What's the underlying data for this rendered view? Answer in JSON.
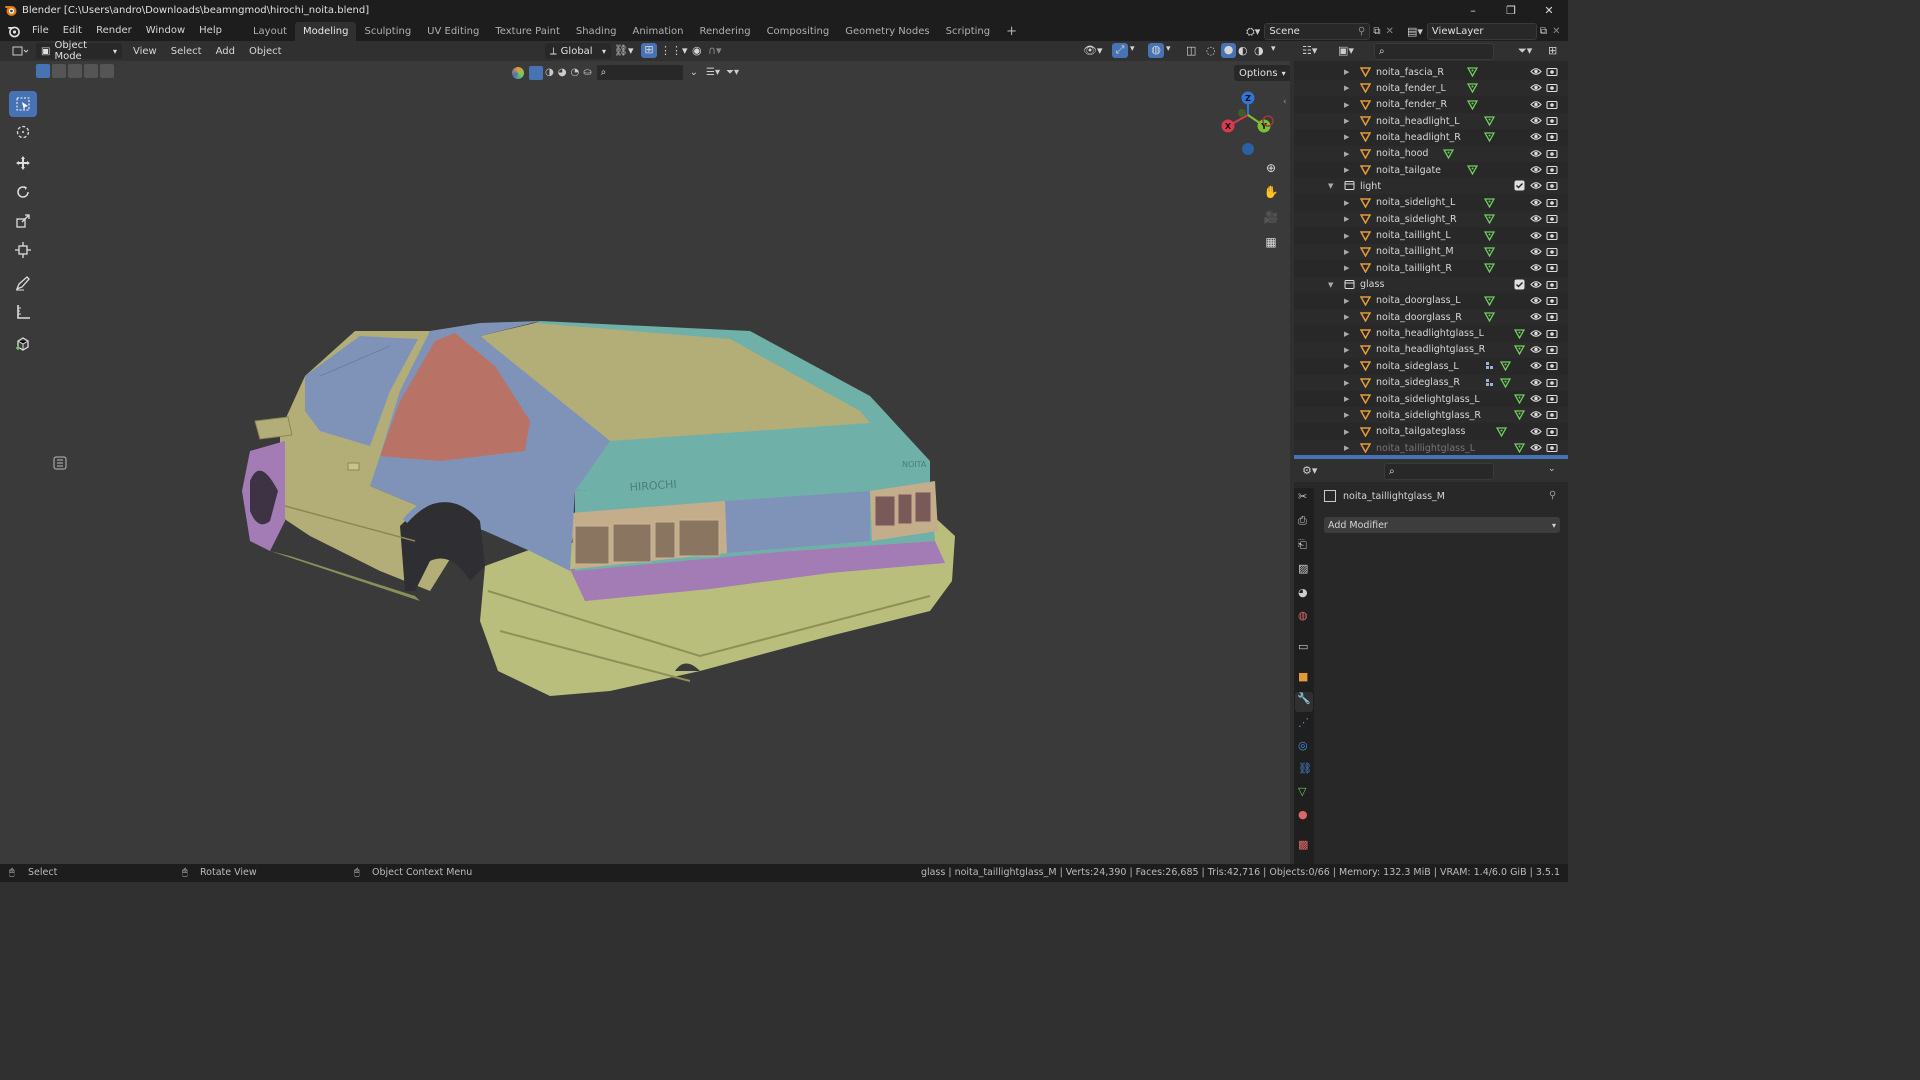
{
  "window": {
    "title": "Blender [C:\\Users\\andro\\Downloads\\beamngmod\\hirochi_noita.blend]",
    "controls": [
      "–",
      "❐",
      "✕"
    ]
  },
  "menu": {
    "items": [
      "File",
      "Edit",
      "Render",
      "Window",
      "Help"
    ],
    "workspaces": [
      "Layout",
      "Modeling",
      "Sculpting",
      "UV Editing",
      "Texture Paint",
      "Shading",
      "Animation",
      "Rendering",
      "Compositing",
      "Geometry Nodes",
      "Scripting"
    ],
    "active_workspace": "Modeling",
    "add_tab": "+",
    "scene_label": "Scene",
    "viewlayer_label": "ViewLayer"
  },
  "viewport_header": {
    "mode": "Object Mode",
    "menus": [
      "View",
      "Select",
      "Add",
      "Object"
    ],
    "orientation": "Global",
    "options": "Options"
  },
  "outliner": {
    "rows": [
      {
        "name": "noita_fascia_R",
        "type": "mesh",
        "level": 2
      },
      {
        "name": "noita_fender_L",
        "type": "mesh",
        "level": 2
      },
      {
        "name": "noita_fender_R",
        "type": "mesh",
        "level": 2
      },
      {
        "name": "noita_headlight_L",
        "type": "mesh",
        "level": 2
      },
      {
        "name": "noita_headlight_R",
        "type": "mesh",
        "level": 2
      },
      {
        "name": "noita_hood",
        "type": "mesh",
        "level": 2
      },
      {
        "name": "noita_tailgate",
        "type": "mesh",
        "level": 2
      },
      {
        "name": "light",
        "type": "collection",
        "level": 1
      },
      {
        "name": "noita_sidelight_L",
        "type": "mesh",
        "level": 2
      },
      {
        "name": "noita_sidelight_R",
        "type": "mesh",
        "level": 2
      },
      {
        "name": "noita_taillight_L",
        "type": "mesh",
        "level": 2
      },
      {
        "name": "noita_taillight_M",
        "type": "mesh",
        "level": 2
      },
      {
        "name": "noita_taillight_R",
        "type": "mesh",
        "level": 2
      },
      {
        "name": "glass",
        "type": "collection",
        "level": 1
      },
      {
        "name": "noita_doorglass_L",
        "type": "mesh",
        "level": 2
      },
      {
        "name": "noita_doorglass_R",
        "type": "mesh",
        "level": 2
      },
      {
        "name": "noita_headlightglass_L",
        "type": "mesh",
        "level": 2
      },
      {
        "name": "noita_headlightglass_R",
        "type": "mesh",
        "level": 2
      },
      {
        "name": "noita_sideglass_L",
        "type": "mesh",
        "level": 2,
        "modifier": true
      },
      {
        "name": "noita_sideglass_R",
        "type": "mesh",
        "level": 2,
        "modifier": true
      },
      {
        "name": "noita_sidelightglass_L",
        "type": "mesh",
        "level": 2
      },
      {
        "name": "noita_sidelightglass_R",
        "type": "mesh",
        "level": 2
      },
      {
        "name": "noita_tailgateglass",
        "type": "mesh",
        "level": 2
      },
      {
        "name": "noita_taillightglass_L",
        "type": "mesh",
        "level": 2,
        "dim": true
      }
    ]
  },
  "properties": {
    "object_name": "noita_taillightglass_M",
    "add_modifier": "Add Modifier"
  },
  "car": {
    "brand_text": "HIROCHI",
    "badge_text": "NOITA"
  },
  "gizmo": {
    "x": "X",
    "y": "Y",
    "z": "Z"
  },
  "statusbar": {
    "select": "Select",
    "rotate": "Rotate View",
    "context": "Object Context Menu",
    "stats": "glass | noita_taillightglass_M | Verts:24,390 | Faces:26,685 | Tris:42,716 | Objects:0/66 | Memory: 132.3 MiB | VRAM: 1.4/6.0 GiB | 3.5.1"
  },
  "colors": {
    "accent": "#4772b3",
    "panel_teal": "#6fb0a9",
    "panel_blue": "#7f93b8",
    "panel_olive": "#b9be7c",
    "panel_khaki": "#b3ad77",
    "panel_red": "#b97266",
    "panel_purple": "#a37cb6",
    "panel_tan": "#c4ad8b",
    "mesh_icon": "#e39a3a",
    "data_icon": "#6fcf5e"
  }
}
